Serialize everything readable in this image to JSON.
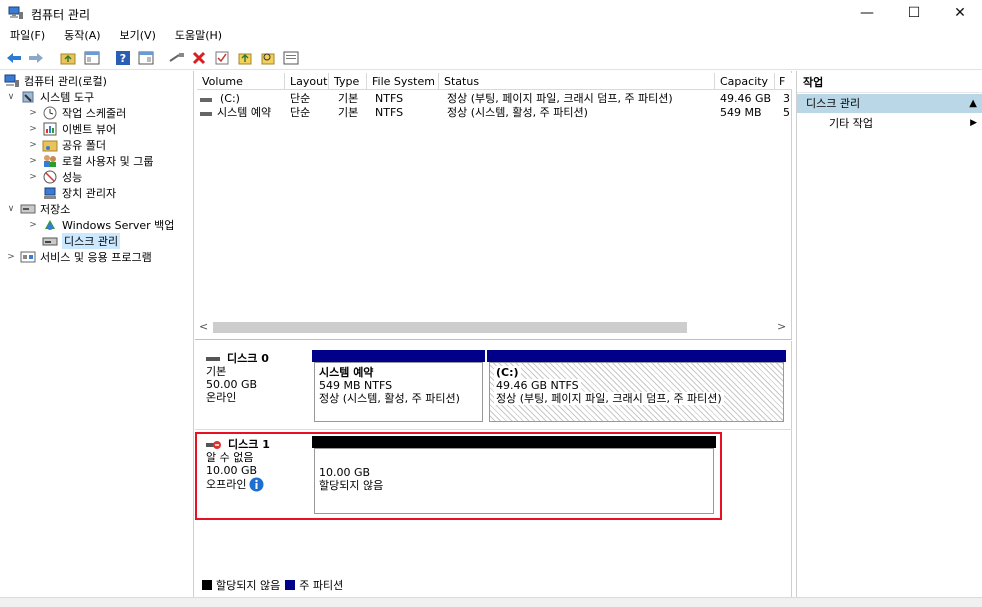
{
  "window": {
    "title": "컴퓨터 관리",
    "controls": [
      "—",
      "☐",
      "✕"
    ]
  },
  "menu": [
    "파일(F)",
    "동작(A)",
    "보기(V)",
    "도움말(H)"
  ],
  "toolbar_icons": [
    "back-arrow-icon",
    "forward-arrow-icon",
    "up-folder-icon",
    "show-hide-tree-icon",
    "help-icon",
    "properties-icon",
    "connect-icon",
    "delete-icon",
    "check-icon",
    "export-icon",
    "search-icon",
    "action-pane-icon"
  ],
  "tree": {
    "root": "컴퓨터 관리(로컬)",
    "system_tools": "시스템 도구",
    "task_scheduler": "작업 스케줄러",
    "event_viewer": "이벤트 뷰어",
    "shared_folders": "공유 폴더",
    "local_users": "로컬 사용자 및 그룹",
    "performance": "성능",
    "device_manager": "장치 관리자",
    "storage": "저장소",
    "backup": "Windows Server 백업",
    "disk_mgmt": "디스크 관리",
    "services_apps": "서비스 및 응용 프로그램"
  },
  "volumes": {
    "headers": [
      "Volume",
      "Layout",
      "Type",
      "File System",
      "Status",
      "Capacity",
      "F"
    ],
    "rows": [
      [
        "(C:)",
        "단순",
        "기본",
        "NTFS",
        "정상 (부팅, 페이지 파일, 크래시 덤프, 주 파티션)",
        "49.46 GB",
        "3"
      ],
      [
        "시스템 예약",
        "단순",
        "기본",
        "NTFS",
        "정상 (시스템, 활성, 주 파티션)",
        "549 MB",
        "5"
      ]
    ]
  },
  "disks": {
    "disk0": {
      "name": "디스크 0",
      "type": "기본",
      "size": "50.00 GB",
      "state": "온라인",
      "partitions": [
        {
          "title": "시스템 예약",
          "info": "549 MB NTFS",
          "status": "정상 (시스템, 활성, 주 파티션)"
        },
        {
          "title": "(C:)",
          "info": "49.46 GB NTFS",
          "status": "정상 (부팅, 페이지 파일, 크래시 덤프, 주 파티션)"
        }
      ]
    },
    "disk1": {
      "name": "디스크 1",
      "type": "알 수 없음",
      "size": "10.00 GB",
      "state": "오프라인",
      "partition": {
        "size": "10.00 GB",
        "status": "할당되지 않음"
      }
    }
  },
  "legend": {
    "unallocated": "할당되지 않음",
    "primary": "주 파티션"
  },
  "actions": {
    "header": "작업",
    "section": "디스크 관리",
    "more": "기타 작업"
  },
  "colors": {
    "primary_partition": "#00008b",
    "unallocated": "#000000",
    "highlight": "#e81123",
    "selection": "#cce8ff",
    "action_section": "#b9d7e7"
  }
}
